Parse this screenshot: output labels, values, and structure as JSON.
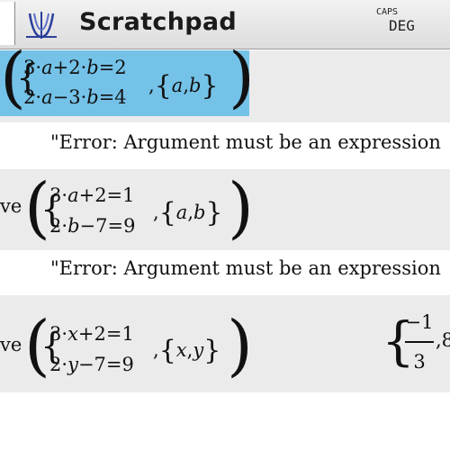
{
  "window": {
    "title": "Scratchpad",
    "indicator_caps": "CAPS",
    "indicator_mode": "DEG"
  },
  "history": [
    {
      "fn": "",
      "eq1": [
        "3",
        "a",
        "+2",
        "b",
        "=2"
      ],
      "eq2": [
        "2",
        "a",
        "−3",
        "b",
        "=4"
      ],
      "vars": [
        "a",
        "b"
      ],
      "result": "\"Error: Argument must be an expression"
    },
    {
      "fn": "ve",
      "eq1": [
        "3",
        "a",
        "+2=1"
      ],
      "eq2": [
        "2",
        "b",
        "−7=9"
      ],
      "vars": [
        "a",
        "b"
      ],
      "result": "\"Error: Argument must be an expression"
    },
    {
      "fn": "ve",
      "eq1": [
        "3",
        "x",
        "+2=1"
      ],
      "eq2": [
        "2",
        "y",
        "−7=9"
      ],
      "vars": [
        "x",
        "y"
      ],
      "result_num": "−1",
      "result_den": "3",
      "result_tail": ",8"
    }
  ],
  "symbols": {
    "dot": "·",
    "comma": ",",
    "paren_open": "(",
    "paren_close": ")",
    "brace_open": "{",
    "brace_close": "}"
  },
  "icons": {
    "app": "graph-function-icon"
  },
  "colors": {
    "selection": "#74c2e8",
    "entry_bg": "#ebebeb",
    "titlebar": "#dcdcdc"
  }
}
